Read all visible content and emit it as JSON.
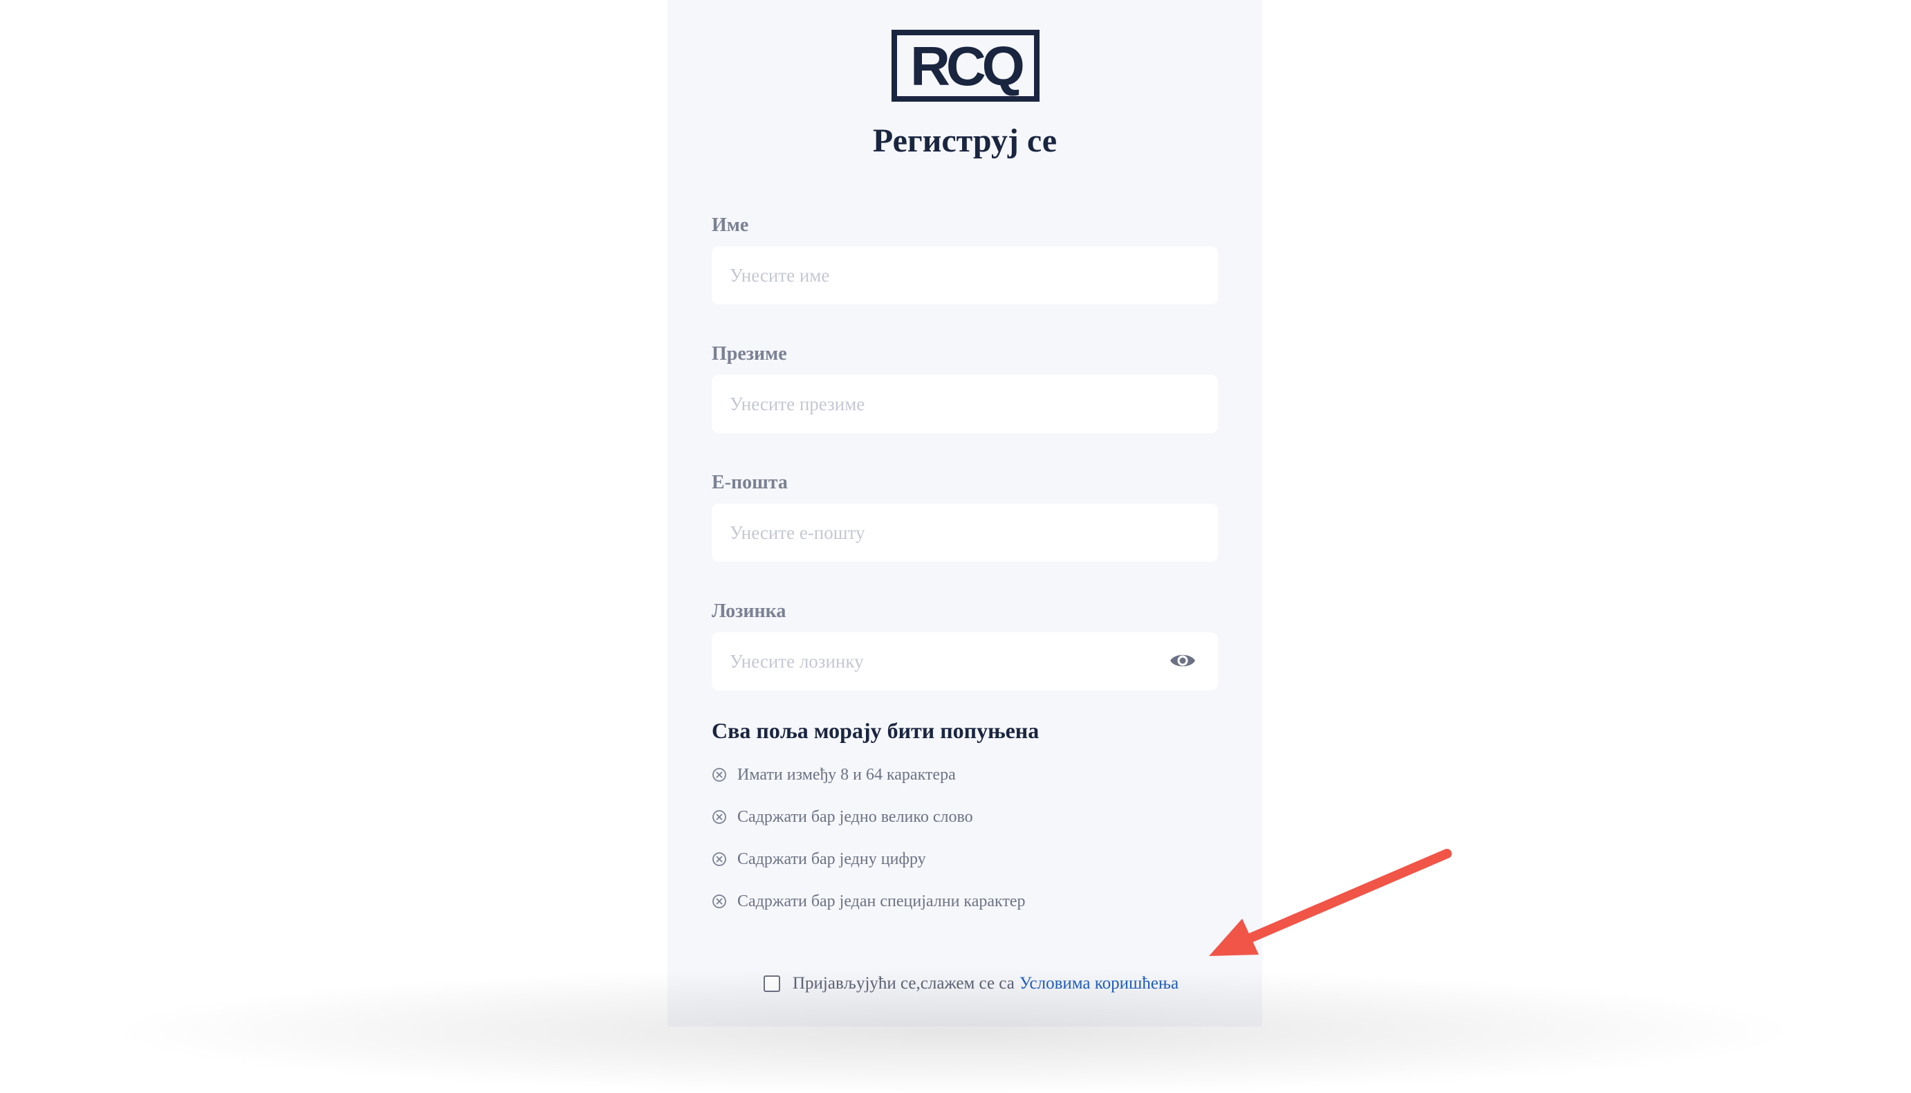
{
  "logo": {
    "text": "RCQ",
    "color": "#1a2540"
  },
  "title": "Региструј се",
  "fields": {
    "first_name": {
      "label": "Име",
      "placeholder": "Унесите име"
    },
    "last_name": {
      "label": "Презиме",
      "placeholder": "Унесите презиме"
    },
    "email": {
      "label": "Е-пошта",
      "placeholder": "Унесите е-пошту"
    },
    "password": {
      "label": "Лозинка",
      "placeholder": "Унесите лозинку",
      "toggle_icon": "eye-icon"
    }
  },
  "requirements": {
    "title": "Сва поља морају бити попуњена",
    "items": [
      "Имати између 8 и 64 карактера",
      "Садржати бар једно велико слово",
      "Садржати бар једну цифру",
      "Садржати бар један специјални карактер"
    ],
    "status_icon": "x-circle-icon"
  },
  "terms": {
    "text": "Пријављујући се,слажем се са",
    "link": "Условима коришћења",
    "checked": false
  },
  "colors": {
    "panel_bg": "#f6f7fb",
    "heading": "#1a2540",
    "link": "#1f5fbf",
    "annotation_arrow": "#f05548"
  }
}
